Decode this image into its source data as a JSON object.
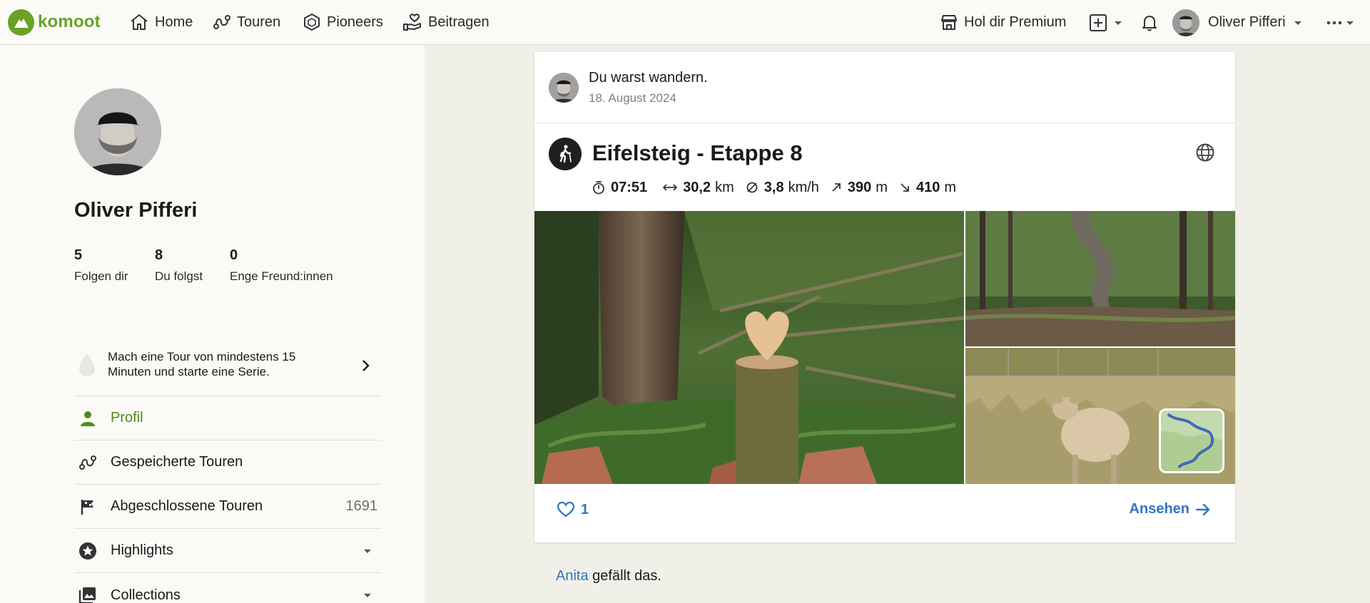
{
  "app": {
    "brand": "komoot",
    "accent": "#6aa127",
    "link_color": "#2f76c2"
  },
  "nav": {
    "items": [
      {
        "label": "Home",
        "icon": "home-icon"
      },
      {
        "label": "Touren",
        "icon": "route-icon"
      },
      {
        "label": "Pioneers",
        "icon": "hexagon-icon"
      },
      {
        "label": "Beitragen",
        "icon": "hand-heart-icon"
      }
    ],
    "premium_label": "Hol dir Premium",
    "user_name": "Oliver Pifferi"
  },
  "profile": {
    "name": "Oliver Pifferi",
    "stats": [
      {
        "value": "5",
        "label": "Folgen dir"
      },
      {
        "value": "8",
        "label": "Du folgst"
      },
      {
        "value": "0",
        "label": "Enge Freund:innen"
      }
    ],
    "streak_text": "Mach eine Tour von mindestens 15 Minuten und starte eine Serie.",
    "menu": [
      {
        "label": "Profil",
        "icon": "person-icon",
        "active": true
      },
      {
        "label": "Gespeicherte Touren",
        "icon": "route-icon"
      },
      {
        "label": "Abgeschlossene Touren",
        "icon": "flag-icon",
        "count": "1691"
      },
      {
        "label": "Highlights",
        "icon": "star-icon"
      },
      {
        "label": "Collections",
        "icon": "collections-icon"
      }
    ]
  },
  "feed": {
    "post": {
      "headline": "Du warst wandern.",
      "date": "18. August 2024",
      "tour_title": "Eifelsteig - Etappe 8",
      "sport_icon": "hiking-icon",
      "visibility_icon": "globe-icon",
      "metrics": {
        "duration": "07:51",
        "distance_value": "30,2",
        "distance_unit": "km",
        "speed_value": "3,8",
        "speed_unit": "km/h",
        "uphill_value": "390",
        "uphill_unit": "m",
        "downhill_value": "410",
        "downhill_unit": "m"
      },
      "likes": "1",
      "view_label": "Ansehen"
    },
    "liked_by": {
      "name": "Anita",
      "text": " gefällt das."
    }
  }
}
